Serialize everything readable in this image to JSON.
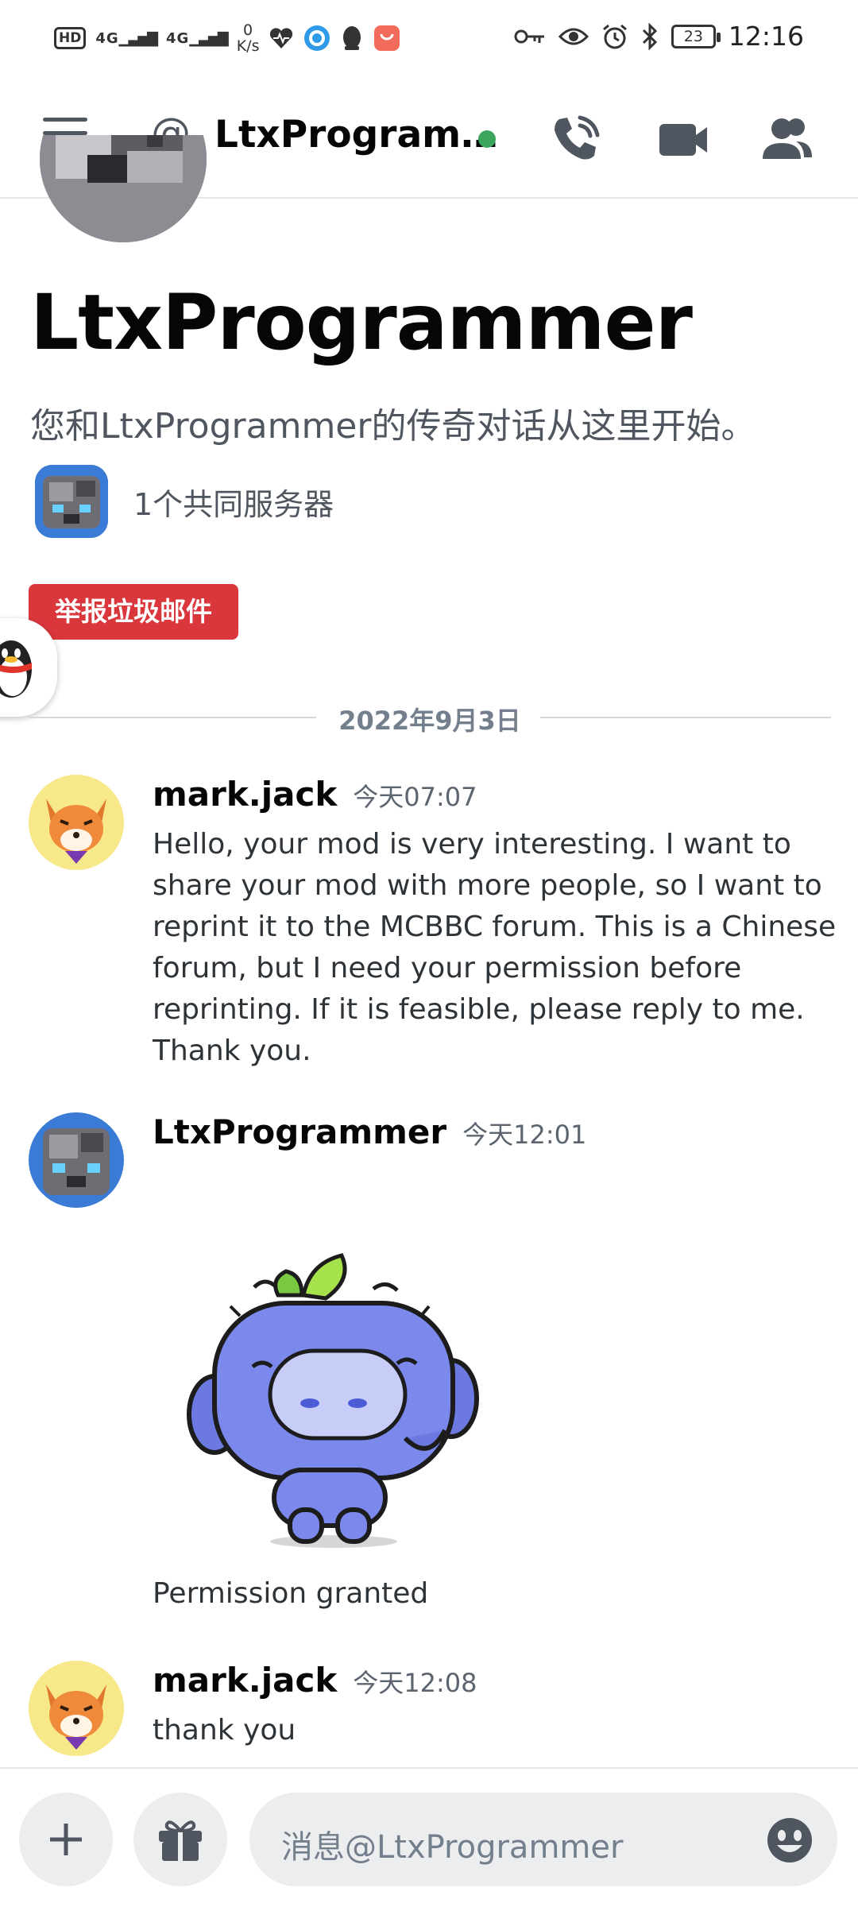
{
  "status_bar": {
    "hd_label": "HD",
    "signal_1": "4G",
    "signal_2": "4G",
    "speed": "0\nK/s",
    "speed_value": "0",
    "speed_unit": "K/s",
    "battery": "23",
    "time": "12:16",
    "icons": [
      "key-icon",
      "eye-icon",
      "alarm-icon",
      "bluetooth-icon"
    ]
  },
  "header": {
    "channel_prefix": "@",
    "channel_name": "LtxProgram…",
    "online_status_color": "#3ba55d",
    "icons": [
      "menu-icon",
      "call-icon",
      "video-icon",
      "members-icon"
    ]
  },
  "profile": {
    "display_name": "LtxProgrammer",
    "intro_text": "您和LtxProgrammer的传奇对话从这里开始。",
    "mutual_servers": "1个共同服务器",
    "report_button": "举报垃圾邮件"
  },
  "date_divider": "2022年9月3日",
  "messages": [
    {
      "author": "mark.jack",
      "time": "今天07:07",
      "text": "Hello, your mod is very interesting. I want to share your mod with more people, so I want to reprint it to the MCBBC forum. This is a Chinese forum, but I need your permission before reprinting. If it is feasible, please reply to me. Thank you."
    },
    {
      "author": "LtxProgrammer",
      "time": "今天12:01",
      "text": "Permission granted"
    },
    {
      "author": "mark.jack",
      "time": "今天12:08",
      "text": "thank you"
    }
  ],
  "composer": {
    "placeholder": "消息@LtxProgrammer"
  },
  "colors": {
    "accent_red": "#da373c",
    "online_green": "#3ba55d",
    "icon_gray": "#4f5660"
  }
}
